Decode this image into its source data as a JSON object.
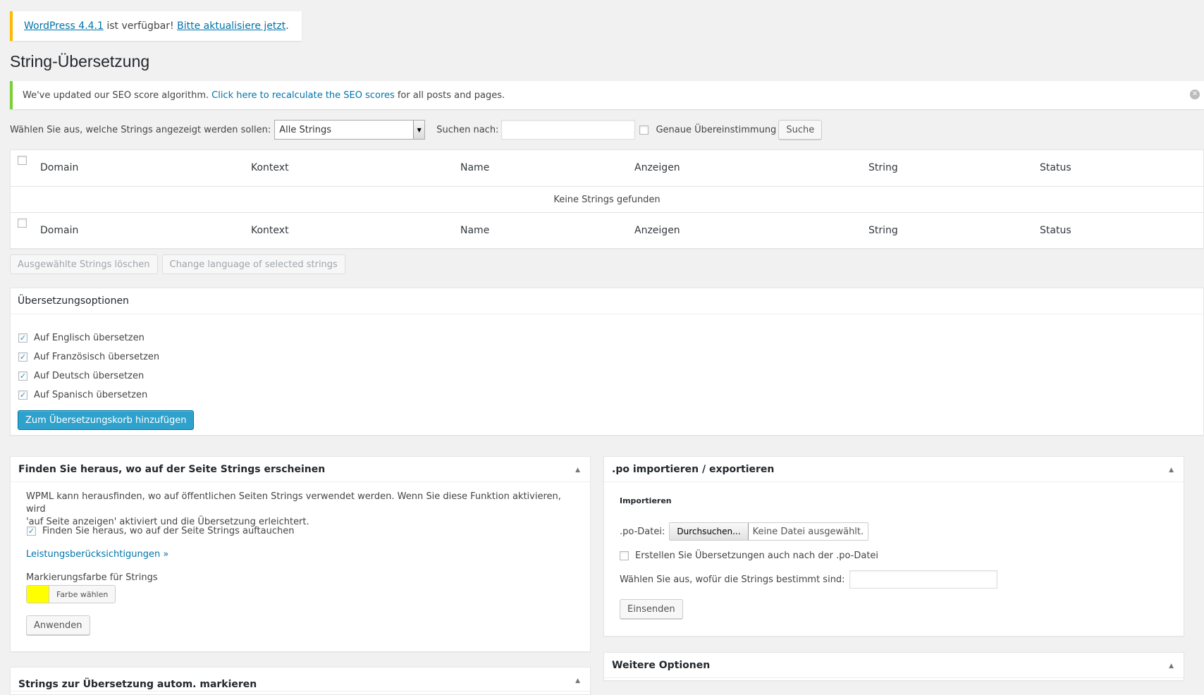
{
  "update_nag": {
    "link1": "WordPress 4.4.1",
    "middle": "ist verfügbar!",
    "link2": "Bitte aktualisiere jetzt",
    "end": "."
  },
  "page": {
    "title": "String-Übersetzung"
  },
  "notice": {
    "pre": "We've updated our SEO score algorithm.",
    "link": "Click here to recalculate the SEO scores",
    "post": "for all posts and pages."
  },
  "filter": {
    "label": "Wählen Sie aus, welche Strings angezeigt werden sollen:",
    "select_value": "Alle Strings",
    "search_label": "Suchen nach:",
    "search_value": "",
    "exact_label": "Genaue Übereinstimmung",
    "exact_checked": false,
    "search_button": "Suche"
  },
  "table": {
    "columns": [
      "Domain",
      "Kontext",
      "Name",
      "Anzeigen",
      "String",
      "Status"
    ],
    "empty_message": "Keine Strings gefunden"
  },
  "bulk": {
    "delete_button": "Ausgewählte Strings löschen",
    "change_lang_button": "Change language of selected strings"
  },
  "options": {
    "title": "Übersetzungsoptionen",
    "items": [
      {
        "label": "Auf Englisch übersetzen",
        "checked": true
      },
      {
        "label": "Auf Französisch übersetzen",
        "checked": true
      },
      {
        "label": "Auf Deutsch übersetzen",
        "checked": true
      },
      {
        "label": "Auf Spanisch übersetzen",
        "checked": true
      }
    ],
    "add_button": "Zum Übersetzungskorb hinzufügen"
  },
  "find_box": {
    "title": "Finden Sie heraus, wo auf der Seite Strings erscheinen",
    "description_line1": "WPML kann herausfinden, wo auf öffentlichen Seiten Strings verwendet werden. Wenn Sie diese Funktion aktivieren, wird",
    "description_line2": "'auf Seite anzeigen' aktiviert und die Übersetzung erleichtert.",
    "checkbox_label": "Finden Sie heraus, wo auf der Seite Strings auftauchen",
    "checkbox_checked": true,
    "perf_link": "Leistungsberücksichtigungen »",
    "color_label": "Markierungsfarbe für Strings",
    "color_value": "#ffff00",
    "color_button": "Farbe wählen",
    "apply_button": "Anwenden"
  },
  "auto_box": {
    "title": "Strings zur Übersetzung autom. markieren"
  },
  "po_box": {
    "title": ".po importieren / exportieren",
    "import_label": "Importieren",
    "file_label": ".po-Datei:",
    "browse_button": "Durchsuchen...",
    "no_file": "Keine Datei ausgewählt.",
    "create_label": "Erstellen Sie Übersetzungen auch nach der .po-Datei",
    "create_checked": false,
    "target_label": "Wählen Sie aus, wofür die Strings bestimmt sind:",
    "target_value": "",
    "submit_button": "Einsenden"
  },
  "more_box": {
    "title": "Weitere Optionen"
  },
  "icons": {
    "close": "close-icon",
    "dropdown": "chevron-down-icon",
    "toggle": "triangle-up-icon"
  }
}
